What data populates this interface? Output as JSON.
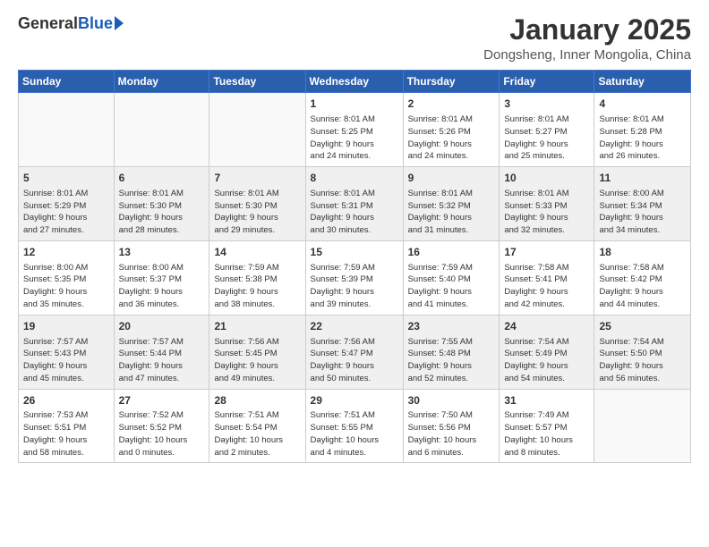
{
  "header": {
    "logo_general": "General",
    "logo_blue": "Blue",
    "month_title": "January 2025",
    "location": "Dongsheng, Inner Mongolia, China"
  },
  "weekdays": [
    "Sunday",
    "Monday",
    "Tuesday",
    "Wednesday",
    "Thursday",
    "Friday",
    "Saturday"
  ],
  "weeks": [
    [
      {
        "day": "",
        "info": ""
      },
      {
        "day": "",
        "info": ""
      },
      {
        "day": "",
        "info": ""
      },
      {
        "day": "1",
        "info": "Sunrise: 8:01 AM\nSunset: 5:25 PM\nDaylight: 9 hours\nand 24 minutes."
      },
      {
        "day": "2",
        "info": "Sunrise: 8:01 AM\nSunset: 5:26 PM\nDaylight: 9 hours\nand 24 minutes."
      },
      {
        "day": "3",
        "info": "Sunrise: 8:01 AM\nSunset: 5:27 PM\nDaylight: 9 hours\nand 25 minutes."
      },
      {
        "day": "4",
        "info": "Sunrise: 8:01 AM\nSunset: 5:28 PM\nDaylight: 9 hours\nand 26 minutes."
      }
    ],
    [
      {
        "day": "5",
        "info": "Sunrise: 8:01 AM\nSunset: 5:29 PM\nDaylight: 9 hours\nand 27 minutes."
      },
      {
        "day": "6",
        "info": "Sunrise: 8:01 AM\nSunset: 5:30 PM\nDaylight: 9 hours\nand 28 minutes."
      },
      {
        "day": "7",
        "info": "Sunrise: 8:01 AM\nSunset: 5:30 PM\nDaylight: 9 hours\nand 29 minutes."
      },
      {
        "day": "8",
        "info": "Sunrise: 8:01 AM\nSunset: 5:31 PM\nDaylight: 9 hours\nand 30 minutes."
      },
      {
        "day": "9",
        "info": "Sunrise: 8:01 AM\nSunset: 5:32 PM\nDaylight: 9 hours\nand 31 minutes."
      },
      {
        "day": "10",
        "info": "Sunrise: 8:01 AM\nSunset: 5:33 PM\nDaylight: 9 hours\nand 32 minutes."
      },
      {
        "day": "11",
        "info": "Sunrise: 8:00 AM\nSunset: 5:34 PM\nDaylight: 9 hours\nand 34 minutes."
      }
    ],
    [
      {
        "day": "12",
        "info": "Sunrise: 8:00 AM\nSunset: 5:35 PM\nDaylight: 9 hours\nand 35 minutes."
      },
      {
        "day": "13",
        "info": "Sunrise: 8:00 AM\nSunset: 5:37 PM\nDaylight: 9 hours\nand 36 minutes."
      },
      {
        "day": "14",
        "info": "Sunrise: 7:59 AM\nSunset: 5:38 PM\nDaylight: 9 hours\nand 38 minutes."
      },
      {
        "day": "15",
        "info": "Sunrise: 7:59 AM\nSunset: 5:39 PM\nDaylight: 9 hours\nand 39 minutes."
      },
      {
        "day": "16",
        "info": "Sunrise: 7:59 AM\nSunset: 5:40 PM\nDaylight: 9 hours\nand 41 minutes."
      },
      {
        "day": "17",
        "info": "Sunrise: 7:58 AM\nSunset: 5:41 PM\nDaylight: 9 hours\nand 42 minutes."
      },
      {
        "day": "18",
        "info": "Sunrise: 7:58 AM\nSunset: 5:42 PM\nDaylight: 9 hours\nand 44 minutes."
      }
    ],
    [
      {
        "day": "19",
        "info": "Sunrise: 7:57 AM\nSunset: 5:43 PM\nDaylight: 9 hours\nand 45 minutes."
      },
      {
        "day": "20",
        "info": "Sunrise: 7:57 AM\nSunset: 5:44 PM\nDaylight: 9 hours\nand 47 minutes."
      },
      {
        "day": "21",
        "info": "Sunrise: 7:56 AM\nSunset: 5:45 PM\nDaylight: 9 hours\nand 49 minutes."
      },
      {
        "day": "22",
        "info": "Sunrise: 7:56 AM\nSunset: 5:47 PM\nDaylight: 9 hours\nand 50 minutes."
      },
      {
        "day": "23",
        "info": "Sunrise: 7:55 AM\nSunset: 5:48 PM\nDaylight: 9 hours\nand 52 minutes."
      },
      {
        "day": "24",
        "info": "Sunrise: 7:54 AM\nSunset: 5:49 PM\nDaylight: 9 hours\nand 54 minutes."
      },
      {
        "day": "25",
        "info": "Sunrise: 7:54 AM\nSunset: 5:50 PM\nDaylight: 9 hours\nand 56 minutes."
      }
    ],
    [
      {
        "day": "26",
        "info": "Sunrise: 7:53 AM\nSunset: 5:51 PM\nDaylight: 9 hours\nand 58 minutes."
      },
      {
        "day": "27",
        "info": "Sunrise: 7:52 AM\nSunset: 5:52 PM\nDaylight: 10 hours\nand 0 minutes."
      },
      {
        "day": "28",
        "info": "Sunrise: 7:51 AM\nSunset: 5:54 PM\nDaylight: 10 hours\nand 2 minutes."
      },
      {
        "day": "29",
        "info": "Sunrise: 7:51 AM\nSunset: 5:55 PM\nDaylight: 10 hours\nand 4 minutes."
      },
      {
        "day": "30",
        "info": "Sunrise: 7:50 AM\nSunset: 5:56 PM\nDaylight: 10 hours\nand 6 minutes."
      },
      {
        "day": "31",
        "info": "Sunrise: 7:49 AM\nSunset: 5:57 PM\nDaylight: 10 hours\nand 8 minutes."
      },
      {
        "day": "",
        "info": ""
      }
    ]
  ]
}
